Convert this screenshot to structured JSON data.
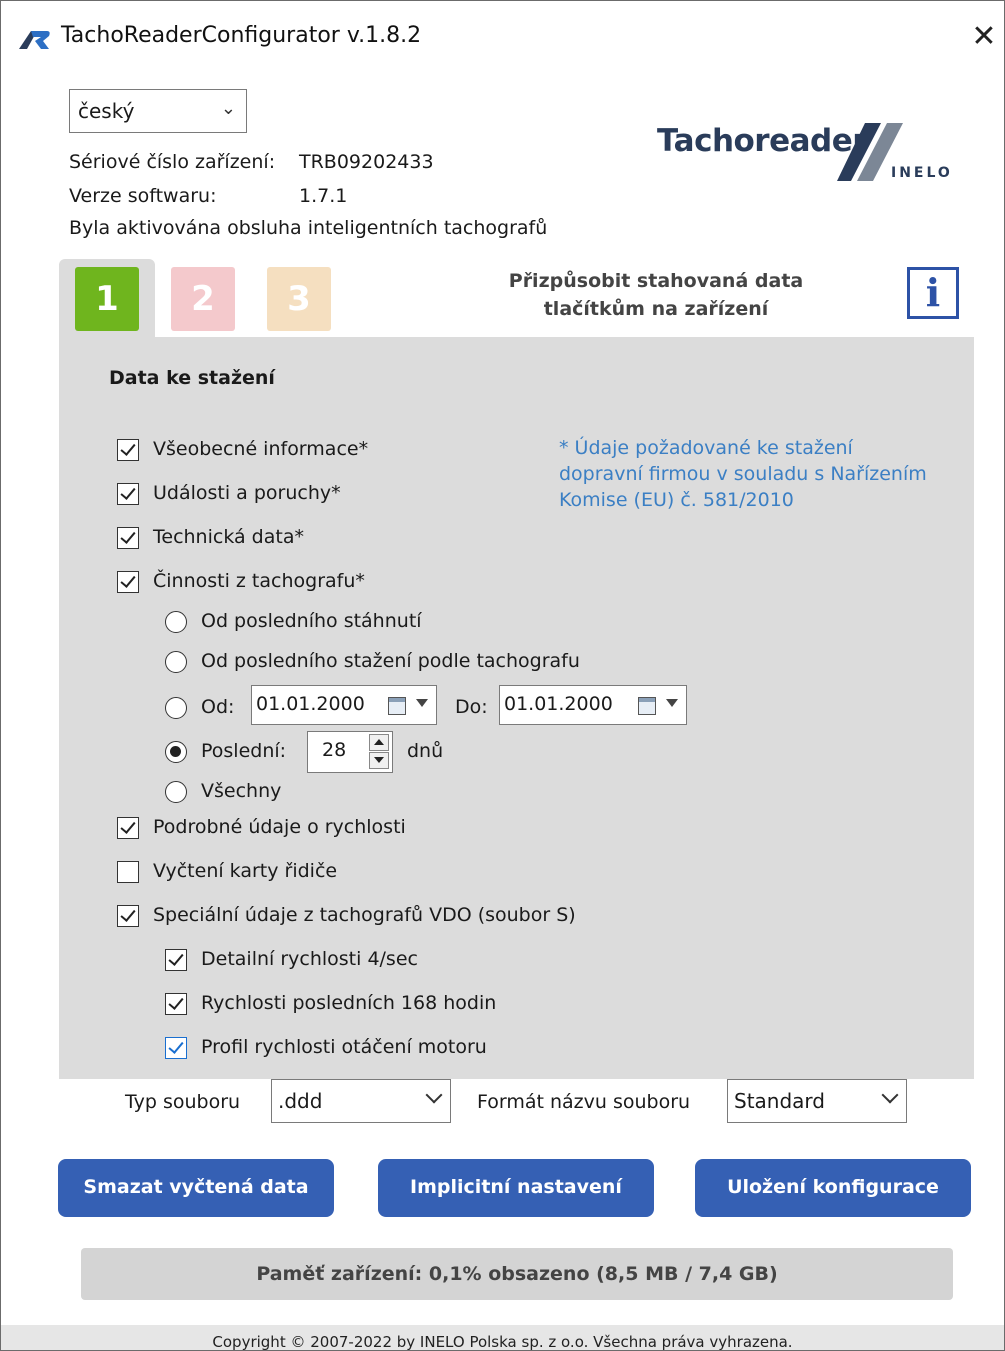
{
  "window": {
    "title": "TachoReaderConfigurator v.1.8.2",
    "close_glyph": "✕"
  },
  "language": {
    "selected": "český"
  },
  "device": {
    "serial_label": "Sériové číslo zařízení:",
    "serial_value": "TRB09202433",
    "version_label": "Verze softwaru:",
    "version_value": "1.7.1",
    "smart_notice": "Byla aktivována obsluha inteligentních tachografů"
  },
  "logo": {
    "word": "Tachoreader",
    "sub": "INELO"
  },
  "tabs": [
    {
      "label": "1",
      "active": true
    },
    {
      "label": "2"
    },
    {
      "label": "3"
    }
  ],
  "tab_caption_line1": "Přizpůsobit stahovaná data",
  "tab_caption_line2": "tlačítkům na zařízení",
  "info_button": "i",
  "section_title": "Data ke stažení",
  "note": "* Údaje požadované ke stažení dopravní firmou v souladu s Nařízením Komise (EU) č. 581/2010",
  "options": {
    "general": {
      "label": "Všeobecné informace*",
      "checked": true
    },
    "events": {
      "label": "Události a poruchy*",
      "checked": true
    },
    "technical": {
      "label": "Technická data*",
      "checked": true
    },
    "activities": {
      "label": "Činnosti z tachografu*",
      "checked": true
    },
    "speed": {
      "label": "Podrobné údaje o rychlosti",
      "checked": true
    },
    "driver_card": {
      "label": "Vyčtení karty řidiče",
      "checked": false
    },
    "vdo": {
      "label": "Speciální údaje z tachografů VDO (soubor S)",
      "checked": true
    },
    "vdo_detail": {
      "label": "Detailní rychlosti 4/sec",
      "checked": true
    },
    "vdo_168": {
      "label": "Rychlosti posledních 168 hodin",
      "checked": true
    },
    "vdo_rpm": {
      "label": "Profil rychlosti otáčení motoru",
      "checked": true
    }
  },
  "range": {
    "since_last": "Od posledního stáhnutí",
    "since_last_tacho": "Od posledního stažení podle tachografu",
    "from_label": "Od:",
    "from_value": "01.01.2000",
    "to_label": "Do:",
    "to_value": "01.01.2000",
    "last_label": "Poslední:",
    "last_value": "28",
    "last_unit": "dnů",
    "all": "Všechny",
    "selected": "last"
  },
  "file_type": {
    "label": "Typ souboru",
    "value": ".ddd"
  },
  "file_name_format": {
    "label": "Formát názvu souboru",
    "value": "Standard"
  },
  "buttons": {
    "delete": "Smazat vyčtená data",
    "defaults": "Implicitní nastavení",
    "save": "Uložení konfigurace"
  },
  "memory": "Paměť zařízení: 0,1% obsazeno (8,5 MB / 7,4 GB)",
  "footer": "Copyright © 2007-2022 by INELO Polska sp. z o.o. Všechna práva vyhrazena.",
  "colors": {
    "accent_blue": "#3560b4",
    "tab1": "#6fb51e",
    "tab2": "#f4c9cc",
    "tab3": "#f5dfc0",
    "note": "#3b7fc4"
  }
}
